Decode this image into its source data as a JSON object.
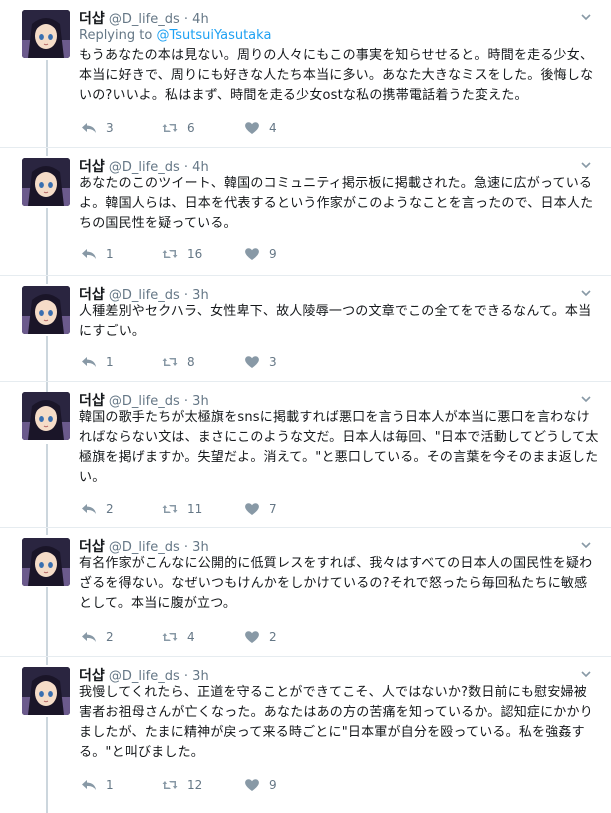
{
  "tweets": [
    {
      "name": "더샵",
      "handle": "@D_life_ds",
      "time": "4h",
      "replying_prefix": "Replying to",
      "replying_to": "@TsutsuiYasutaka",
      "text": "もうあなたの本は見ない。周りの人々にもこの事実を知らせせると。時間を走る少女、本当に好きで、周りにも好きな人たち本当に多い。あなた大きなミスをした。後悔しないの?いいよ。私はまず、時間を走る少女ostな私の携帯電話着うた変えた。",
      "replies": "3",
      "retweets": "6",
      "likes": "4"
    },
    {
      "name": "더샵",
      "handle": "@D_life_ds",
      "time": "4h",
      "text": "あなたのこのツイート、韓国のコミュニティ掲示板に掲載された。急速に広がっているよ。韓国人らは、日本を代表するという作家がこのようなことを言ったので、日本人たちの国民性を疑っている。",
      "replies": "1",
      "retweets": "16",
      "likes": "9"
    },
    {
      "name": "더샵",
      "handle": "@D_life_ds",
      "time": "3h",
      "text": "人種差別やセクハラ、女性卑下、故人陵辱一つの文章でこの全てをできるなんて。本当にすごい。",
      "replies": "1",
      "retweets": "8",
      "likes": "3"
    },
    {
      "name": "더샵",
      "handle": "@D_life_ds",
      "time": "3h",
      "text": "韓国の歌手たちが太極旗をsnsに掲載すれば悪口を言う日本人が本当に悪口を言わなければならない文は、まさにこのような文だ。日本人は毎回、\"日本で活動してどうして太極旗を掲げますか。失望だよ。消えて。\"と悪口している。その言葉を今そのまま返したい。",
      "replies": "2",
      "retweets": "11",
      "likes": "7"
    },
    {
      "name": "더샵",
      "handle": "@D_life_ds",
      "time": "3h",
      "text": "有名作家がこんなに公開的に低質レスをすれば、我々はすべての日本人の国民性を疑わざるを得ない。なぜいつもけんかをしかけているの?それで怒ったら毎回私たちに敏感として。本当に腹が立つ。",
      "replies": "2",
      "retweets": "4",
      "likes": "2"
    },
    {
      "name": "더샵",
      "handle": "@D_life_ds",
      "time": "3h",
      "text": "我慢してくれたら、正道を守ることができてこそ、人ではないか?数日前にも慰安婦被害者お祖母さんが亡くなった。あなたはあの方の苦痛を知っているか。認知症にかかりましたが、たまに精神が戻って来る時ごとに\"日本軍が自分を殴っている。私を強姦する。\"と叫びました。",
      "replies": "1",
      "retweets": "12",
      "likes": "9"
    }
  ],
  "icons": {
    "reply": "reply-icon",
    "retweet": "retweet-icon",
    "like": "heart-icon",
    "caret": "chevron-down-icon"
  },
  "colors": {
    "muted": "#657786",
    "link": "#1da1f2",
    "thread_line": "#ccd6dd",
    "divider": "#e6ecf0"
  }
}
